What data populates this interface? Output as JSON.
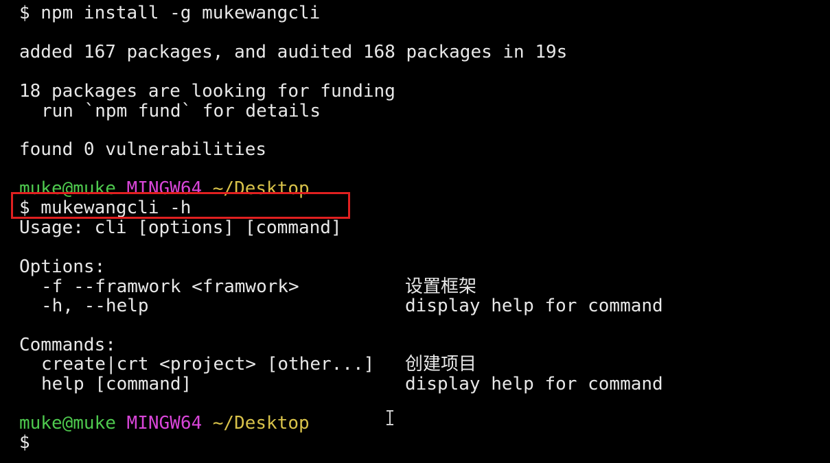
{
  "terminal": {
    "cmd_install": "$ npm install -g mukewangcli",
    "added": "added 167 packages, and audited 168 packages in 19s",
    "funding": "18 packages are looking for funding",
    "fund_hint": "run `npm fund` for details",
    "vulns": "found 0 vulnerabilities",
    "prompt1": {
      "user": "muke@muke",
      "system": "MINGW64",
      "path": "~/Desktop"
    },
    "cmd_help": "$ mukewangcli -h",
    "usage": "Usage: cli [options] [command]",
    "options_header": "Options:",
    "options": [
      {
        "flag": "-f --framwork <framwork>",
        "desc": "设置框架"
      },
      {
        "flag": "-h, --help",
        "desc": "display help for command"
      }
    ],
    "commands_header": "Commands:",
    "commands": [
      {
        "name": "create|crt <project> [other...]",
        "desc": "创建项目"
      },
      {
        "name": "help [command]",
        "desc": "display help for command"
      }
    ],
    "prompt2": {
      "user": "muke@muke",
      "system": "MINGW64",
      "path": "~/Desktop"
    },
    "final_prompt": "$"
  },
  "colors": {
    "background": "#000000",
    "text": "#e8e8e8",
    "prompt_user": "#4ec94e",
    "prompt_system": "#d845d8",
    "prompt_path": "#d8c24a",
    "highlight_border": "#e02020"
  },
  "icons": {
    "mouse_cursor": "text-cursor-icon"
  }
}
